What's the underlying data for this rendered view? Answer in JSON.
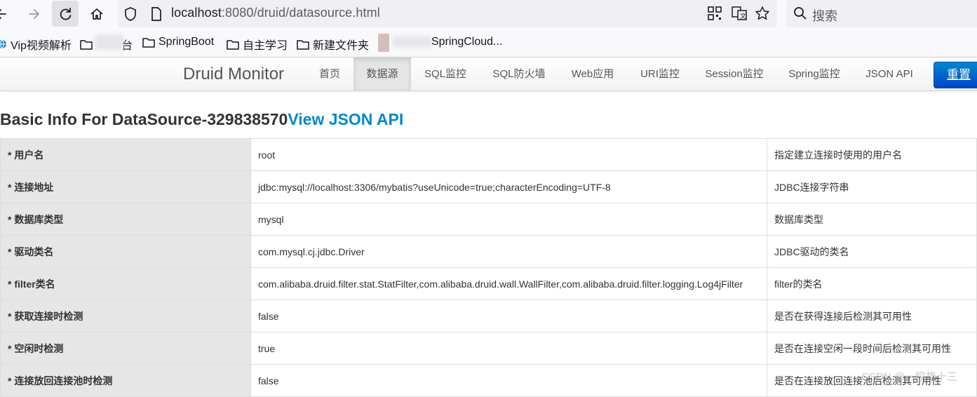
{
  "browser": {
    "url_host": "localhost",
    "url_rest": ":8080/druid/datasource.html",
    "search_placeholder": "搜索"
  },
  "bookmarks": [
    {
      "label": "Vip视频解析"
    },
    {
      "label": "台"
    },
    {
      "label": "SpringBoot"
    },
    {
      "label": "自主学习"
    },
    {
      "label": "新建文件夹"
    },
    {
      "label": "SpringCloud..."
    }
  ],
  "navbar": {
    "brand": "Druid Monitor",
    "items": [
      {
        "label": "首页"
      },
      {
        "label": "数据源"
      },
      {
        "label": "SQL监控"
      },
      {
        "label": "SQL防火墙"
      },
      {
        "label": "Web应用"
      },
      {
        "label": "URI监控"
      },
      {
        "label": "Session监控"
      },
      {
        "label": "Spring监控"
      },
      {
        "label": "JSON API"
      }
    ],
    "reset_label": "重置"
  },
  "heading": {
    "title": "Basic Info For DataSource-329838570",
    "link": "View JSON API"
  },
  "rows": [
    {
      "key": "* 用户名",
      "value": "root",
      "desc": "指定建立连接时使用的用户名"
    },
    {
      "key": "* 连接地址",
      "value": "jdbc:mysql://localhost:3306/mybatis?useUnicode=true;characterEncoding=UTF-8",
      "desc": "JDBC连接字符串"
    },
    {
      "key": "* 数据库类型",
      "value": "mysql",
      "desc": "数据库类型"
    },
    {
      "key": "* 驱动类名",
      "value": "com.mysql.cj.jdbc.Driver",
      "desc": "JDBC驱动的类名"
    },
    {
      "key": "* filter类名",
      "value": "com.alibaba.druid.filter.stat.StatFilter,com.alibaba.druid.wall.WallFilter,com.alibaba.druid.filter.logging.Log4jFilter",
      "desc": "filter的类名"
    },
    {
      "key": "* 获取连接时检测",
      "value": "false",
      "desc": "是否在获得连接后检测其可用性"
    },
    {
      "key": "* 空闲时检测",
      "value": "true",
      "desc": "是否在连接空闲一段时间后检测其可用性"
    },
    {
      "key": "* 连接放回连接池时检测",
      "value": "false",
      "desc": "是否在连接放回连接池后检测其可用性"
    }
  ],
  "watermark": "CSDN @一惊艳十三"
}
